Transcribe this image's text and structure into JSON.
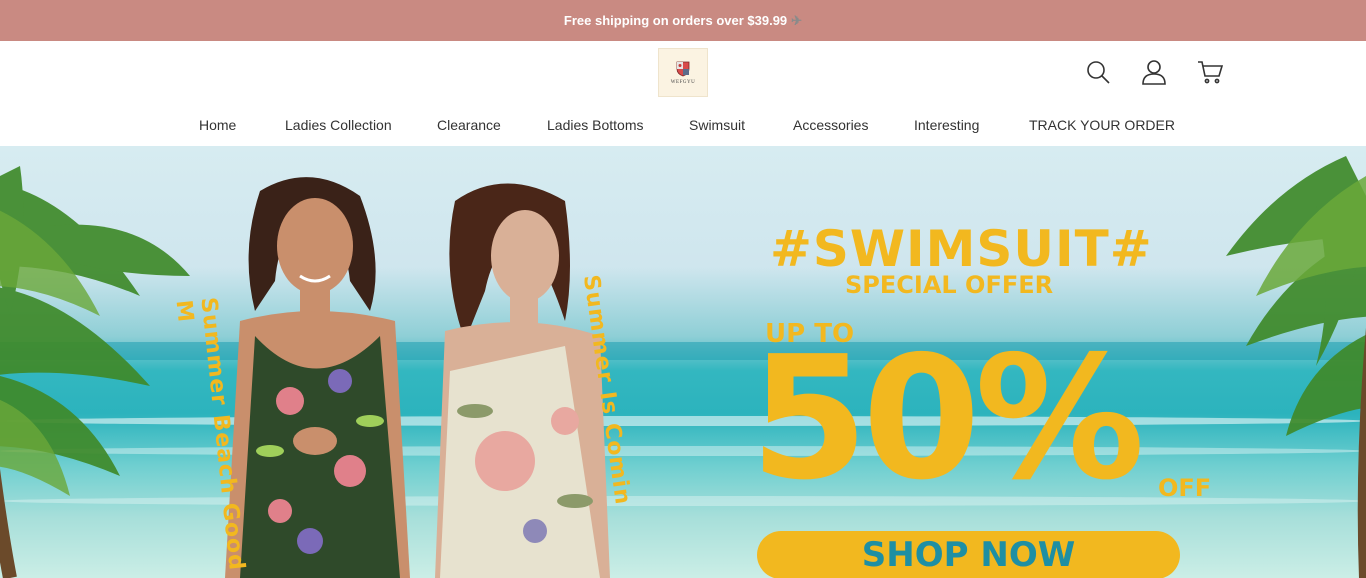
{
  "announcement": {
    "text": "Free shipping on orders over $39.99",
    "icon": "airplane-icon"
  },
  "header": {
    "logo": {
      "brand": "WEFGYU"
    },
    "icons": [
      "search-icon",
      "account-icon",
      "cart-icon"
    ]
  },
  "nav": {
    "items": [
      {
        "label": "Home"
      },
      {
        "label": "Ladies Collection"
      },
      {
        "label": "Clearance"
      },
      {
        "label": "Ladies Bottoms"
      },
      {
        "label": "Swimsuit"
      },
      {
        "label": "Accessories"
      },
      {
        "label": "Interesting"
      },
      {
        "label": "TRACK YOUR ORDER"
      }
    ]
  },
  "hero": {
    "tagline": "#SWIMSUIT#",
    "subtitle": "SPECIAL OFFER",
    "upto": "UP TO",
    "discount": "50%",
    "off": "OFF",
    "cta": "SHOP NOW",
    "arc_left": "Summer Beach Good M",
    "arc_right": "Summer Is Comin",
    "colors": {
      "accent": "#f2b81f",
      "cta_text": "#1e8fa3",
      "banner": "#c98a82"
    }
  }
}
